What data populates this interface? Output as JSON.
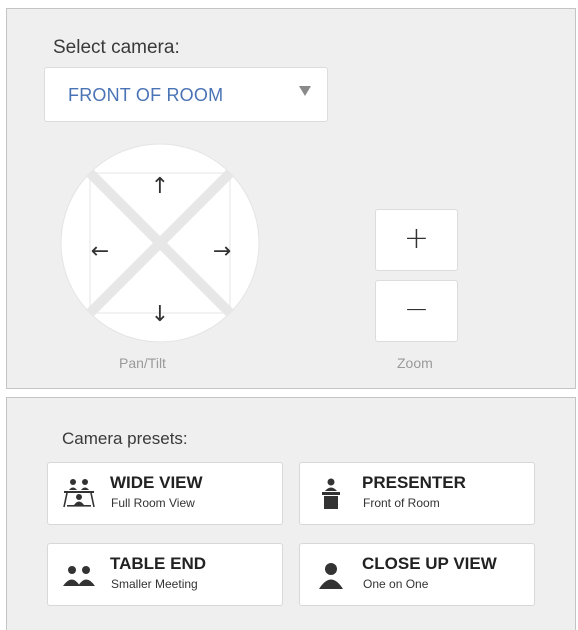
{
  "camera": {
    "heading": "Select camera:",
    "selected": "FRONT OF ROOM",
    "pantilt_label": "Pan/Tilt",
    "zoom_label": "Zoom",
    "zoom_in": "+",
    "zoom_out": "−",
    "arrows": {
      "up": "↑",
      "left": "←",
      "right": "→",
      "down": "↓"
    }
  },
  "presets": {
    "heading": "Camera presets:",
    "items": [
      {
        "title": "WIDE VIEW",
        "subtitle": "Full Room View",
        "icon": "group-table-icon"
      },
      {
        "title": "PRESENTER",
        "subtitle": "Front of Room",
        "icon": "presenter-podium-icon"
      },
      {
        "title": "TABLE END",
        "subtitle": "Smaller Meeting",
        "icon": "two-people-icon"
      },
      {
        "title": "CLOSE UP VIEW",
        "subtitle": "One on One",
        "icon": "single-person-icon"
      }
    ]
  },
  "colors": {
    "accent": "#4a73b5",
    "panel": "#efefef",
    "border": "#c4c4c4"
  }
}
